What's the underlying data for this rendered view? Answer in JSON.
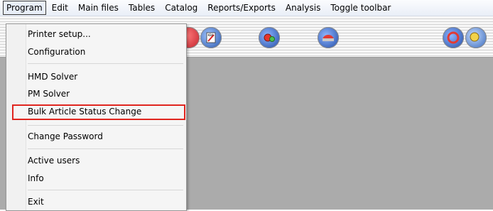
{
  "menubar": {
    "items": [
      "Program",
      "Edit",
      "Main files",
      "Tables",
      "Catalog",
      "Reports/Exports",
      "Analysis",
      "Toggle toolbar"
    ]
  },
  "toolbar": {
    "icons": [
      "report-icon",
      "kba-icon",
      "gears-icon",
      "car-icon",
      "refresh-icon",
      "search-globe-icon"
    ]
  },
  "dropdown": {
    "items": [
      "Printer setup...",
      "Configuration",
      "HMD Solver",
      "PM Solver",
      "Bulk Article Status Change",
      "Change Password",
      "Active users",
      "Info",
      "Exit"
    ],
    "highlighted": "Bulk Article Status Change",
    "highlight_color": "#e0251f"
  },
  "colors": {
    "workspace": "#ababab"
  }
}
